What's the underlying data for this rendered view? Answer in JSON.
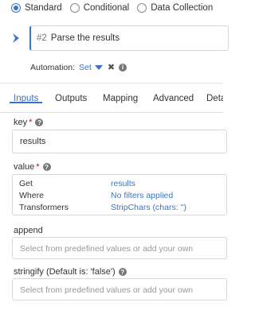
{
  "source_options": [
    {
      "label": "Standard",
      "checked": true
    },
    {
      "label": "Conditional",
      "checked": false
    },
    {
      "label": "Data Collection",
      "checked": false
    }
  ],
  "task": {
    "number": "#2",
    "name": "Parse the results"
  },
  "automation": {
    "label": "Automation:",
    "value": "Set"
  },
  "tabs": [
    "Inputs",
    "Outputs",
    "Mapping",
    "Advanced",
    "Deta"
  ],
  "active_tab": "Inputs",
  "fields": {
    "key": {
      "label": "key",
      "required": "*",
      "value": "results"
    },
    "value": {
      "label": "value",
      "required": "*",
      "rows": [
        {
          "key": "Get",
          "value": "results"
        },
        {
          "key": "Where",
          "value": "No filters applied"
        },
        {
          "key": "Transformers",
          "value": "StripChars (chars: '')"
        }
      ]
    },
    "append": {
      "label": "append",
      "placeholder": "Select from predefined values or add your own"
    },
    "stringify": {
      "label": "stringify (Default is: 'false')",
      "placeholder": "Select from predefined values or add your own"
    }
  },
  "colors": {
    "accent": "#3b74c4",
    "required": "#d0021b"
  }
}
